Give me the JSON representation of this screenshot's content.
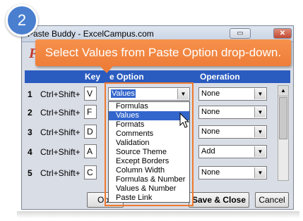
{
  "step_number": "2",
  "window": {
    "title": "Paste Buddy - ExcelCampus.com",
    "restore_icon": "restore-icon",
    "close_label": "✕"
  },
  "app_title": "P",
  "callout": {
    "text": "Select Values from Paste Option drop-down."
  },
  "headers": {
    "key": "Key",
    "paste_option": "Paste Option",
    "paste_option_visible": "e Option",
    "operation": "Operation"
  },
  "rows": [
    {
      "num": "1",
      "hotkey": "Ctrl+Shift+",
      "key": "V",
      "paste": "Values",
      "operation": "None"
    },
    {
      "num": "2",
      "hotkey": "Ctrl+Shift+",
      "key": "F",
      "paste": "",
      "operation": "None"
    },
    {
      "num": "3",
      "hotkey": "Ctrl+Shift+",
      "key": "D",
      "paste": "",
      "operation": "None"
    },
    {
      "num": "4",
      "hotkey": "Ctrl+Shift+",
      "key": "A",
      "paste": "",
      "operation": "Add"
    },
    {
      "num": "5",
      "hotkey": "Ctrl+Shift+",
      "key": "C",
      "paste": "",
      "operation": "None"
    }
  ],
  "dropdown": {
    "items": [
      "Formulas",
      "Values",
      "Formats",
      "Comments",
      "Validation",
      "Source Theme",
      "Except Borders",
      "Column Width",
      "Formulas & Number",
      "Values & Number",
      "Paste Link"
    ],
    "selected_index": 1
  },
  "buttons": {
    "options": "Opti",
    "save_close": "Save & Close",
    "cancel": "Cancel"
  },
  "colors": {
    "accent_orange": "#ee7d38",
    "header_blue": "#2a5bbf",
    "badge_blue": "#4a7fcf"
  }
}
